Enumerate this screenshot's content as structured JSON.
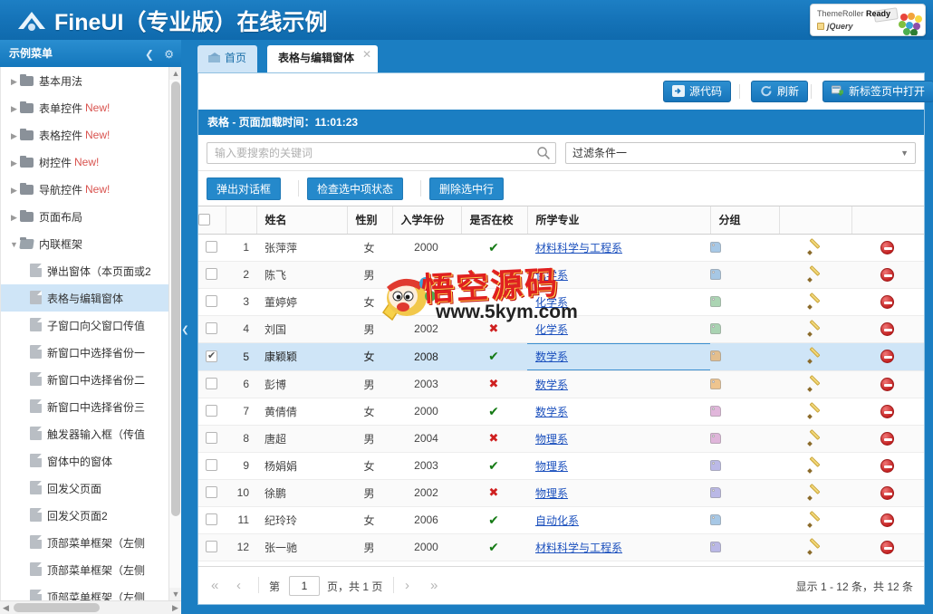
{
  "banner": {
    "title": "FineUI（专业版）在线示例",
    "logo_icon": "fineui-logo-icon",
    "badge": {
      "line1_light": "ThemeRoller ",
      "line1_bold": "Ready",
      "line2": "jQuery"
    }
  },
  "sidebar": {
    "header_title": "示例菜单",
    "collapse_icon": "chevron-left-icon",
    "settings_icon": "gear-icon",
    "items": [
      {
        "label": "基本用法",
        "type": "folder",
        "new": "",
        "selected": false
      },
      {
        "label": "表单控件",
        "type": "folder",
        "new": "New!",
        "selected": false
      },
      {
        "label": "表格控件",
        "type": "folder",
        "new": "New!",
        "selected": false
      },
      {
        "label": "树控件",
        "type": "folder",
        "new": "New!",
        "selected": false
      },
      {
        "label": "导航控件",
        "type": "folder",
        "new": "New!",
        "selected": false
      },
      {
        "label": "页面布局",
        "type": "folder",
        "new": "",
        "selected": false
      },
      {
        "label": "内联框架",
        "type": "folder-open",
        "new": "",
        "selected": false
      },
      {
        "label": "弹出窗体（本页面或2",
        "type": "file",
        "new": "",
        "selected": false
      },
      {
        "label": "表格与编辑窗体",
        "type": "file",
        "new": "",
        "selected": true
      },
      {
        "label": "子窗口向父窗口传值",
        "type": "file",
        "new": "",
        "selected": false
      },
      {
        "label": "新窗口中选择省份一",
        "type": "file",
        "new": "",
        "selected": false
      },
      {
        "label": "新窗口中选择省份二",
        "type": "file",
        "new": "",
        "selected": false
      },
      {
        "label": "新窗口中选择省份三",
        "type": "file",
        "new": "",
        "selected": false
      },
      {
        "label": "触发器输入框（传值",
        "type": "file",
        "new": "",
        "selected": false
      },
      {
        "label": "窗体中的窗体",
        "type": "file",
        "new": "",
        "selected": false
      },
      {
        "label": "回发父页面",
        "type": "file",
        "new": "",
        "selected": false
      },
      {
        "label": "回发父页面2",
        "type": "file",
        "new": "",
        "selected": false
      },
      {
        "label": "顶部菜单框架（左侧",
        "type": "file",
        "new": "",
        "selected": false
      },
      {
        "label": "顶部菜单框架（左侧",
        "type": "file",
        "new": "",
        "selected": false
      },
      {
        "label": "顶部菜单框架（左侧",
        "type": "file",
        "new": "",
        "selected": false
      }
    ]
  },
  "tabs": [
    {
      "label": "首页",
      "icon": "home-icon",
      "active": false,
      "closable": false
    },
    {
      "label": "表格与编辑窗体",
      "icon": "",
      "active": true,
      "closable": true
    }
  ],
  "toolbar": {
    "source_label": "源代码",
    "source_icon": "code-icon",
    "refresh_label": "刷新",
    "refresh_icon": "refresh-icon",
    "newtab_label": "新标签页中打开",
    "newtab_icon": "external-link-icon"
  },
  "panel": {
    "title_prefix": "表格",
    "title_rest": " - 页面加载时间：11:01:23"
  },
  "search": {
    "placeholder": "输入要搜索的关键词",
    "value": "",
    "icon": "search-icon",
    "filter_value": "过滤条件一",
    "filter_caret_icon": "chevron-down-icon"
  },
  "actions": [
    {
      "label": "弹出对话框"
    },
    {
      "label": "检查选中项状态"
    },
    {
      "label": "删除选中行"
    }
  ],
  "grid": {
    "columns": [
      "",
      "",
      "姓名",
      "性别",
      "入学年份",
      "是否在校",
      "所学专业",
      "分组",
      "",
      ""
    ],
    "header_checkbox_checked": false,
    "rows": [
      {
        "checked": false,
        "index": "1",
        "name": "张萍萍",
        "sex": "女",
        "year": "2000",
        "enrolled": true,
        "major": "材料科学与工程系",
        "tag_color": "#8ab6de",
        "focused": false
      },
      {
        "checked": false,
        "index": "2",
        "name": "陈飞",
        "sex": "男",
        "year": "",
        "enrolled": null,
        "major": "化学系",
        "tag_color": "#8ab6de",
        "focused": false
      },
      {
        "checked": false,
        "index": "3",
        "name": "董婷婷",
        "sex": "女",
        "year": "",
        "enrolled": null,
        "major": "化学系",
        "tag_color": "#8fc79a",
        "focused": false
      },
      {
        "checked": false,
        "index": "4",
        "name": "刘国",
        "sex": "男",
        "year": "2002",
        "enrolled": false,
        "major": "化学系",
        "tag_color": "#8fc79a",
        "focused": false
      },
      {
        "checked": true,
        "index": "5",
        "name": "康颖颖",
        "sex": "女",
        "year": "2008",
        "enrolled": true,
        "major": "数学系",
        "tag_color": "#eab26a",
        "focused": true
      },
      {
        "checked": false,
        "index": "6",
        "name": "彭博",
        "sex": "男",
        "year": "2003",
        "enrolled": false,
        "major": "数学系",
        "tag_color": "#eab26a",
        "focused": false
      },
      {
        "checked": false,
        "index": "7",
        "name": "黄倩倩",
        "sex": "女",
        "year": "2000",
        "enrolled": true,
        "major": "数学系",
        "tag_color": "#d79ed0",
        "focused": false
      },
      {
        "checked": false,
        "index": "8",
        "name": "唐超",
        "sex": "男",
        "year": "2004",
        "enrolled": false,
        "major": "物理系",
        "tag_color": "#d79ed0",
        "focused": false
      },
      {
        "checked": false,
        "index": "9",
        "name": "杨娟娟",
        "sex": "女",
        "year": "2003",
        "enrolled": true,
        "major": "物理系",
        "tag_color": "#a5a2e0",
        "focused": false
      },
      {
        "checked": false,
        "index": "10",
        "name": "徐鹏",
        "sex": "男",
        "year": "2002",
        "enrolled": false,
        "major": "物理系",
        "tag_color": "#a5a2e0",
        "focused": false
      },
      {
        "checked": false,
        "index": "11",
        "name": "纪玲玲",
        "sex": "女",
        "year": "2006",
        "enrolled": true,
        "major": "自动化系",
        "tag_color": "#8ab6de",
        "focused": false
      },
      {
        "checked": false,
        "index": "12",
        "name": "张一驰",
        "sex": "男",
        "year": "2000",
        "enrolled": true,
        "major": "材料科学与工程系",
        "tag_color": "#a5a2e0",
        "focused": false
      }
    ],
    "row_tag_icon": "tag-icon",
    "row_edit_icon": "pencil-icon",
    "row_delete_icon": "delete-circle-icon"
  },
  "pager": {
    "first_icon": "double-chevron-left-icon",
    "prev_icon": "chevron-left-icon",
    "next_icon": "chevron-right-icon",
    "last_icon": "double-chevron-right-icon",
    "label_before": "第",
    "page_value": "1",
    "label_after": "页，共 1 页",
    "summary": "显示 1 - 12 条，共 12 条"
  },
  "watermark": {
    "text": "悟空源码",
    "url": "www.5kym.com"
  },
  "colors": {
    "brand_blue": "#1b7ec2",
    "accent_link": "#1a4fbd",
    "ok_green": "#157a15",
    "no_red": "#cf2020",
    "selection": "#cfe5f7"
  }
}
